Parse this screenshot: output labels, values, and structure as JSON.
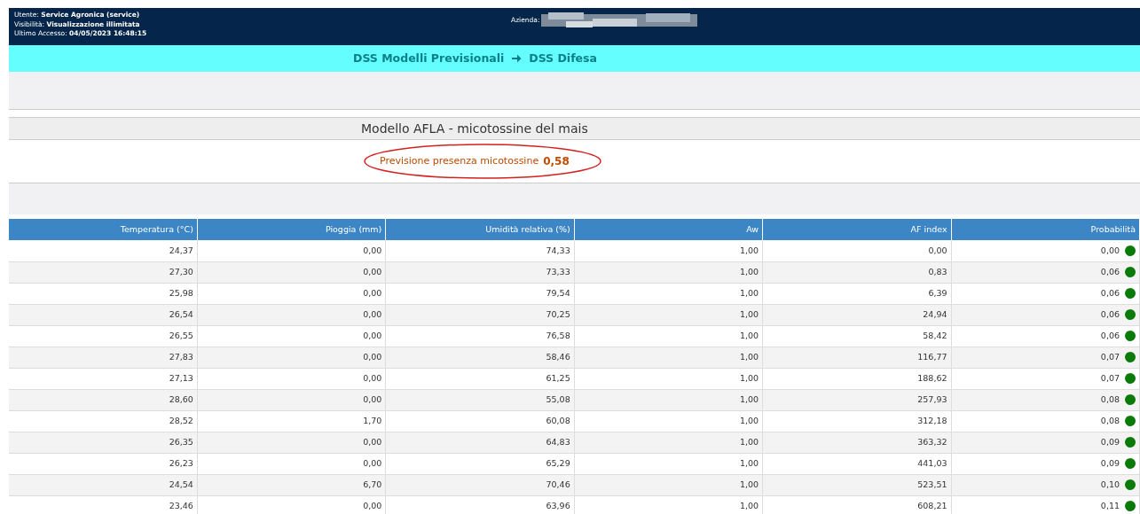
{
  "header": {
    "lines": [
      "Utente: **Service Agronica (service)**",
      "Visibilità: **Visualizzazione illimitata**",
      "Ultimo Accesso: **04/05/2023 16:48:15**"
    ],
    "company_label": "Azienda:"
  },
  "breadcrumb": [
    "DSS Modelli Previsionali",
    "DSS Difesa"
  ],
  "model_title": "Modello AFLA - micotossine del mais",
  "forecast": {
    "label": "Previsione presenza micotossine",
    "value": "0,58"
  },
  "table": {
    "columns": [
      "Temperatura (°C)",
      "Pioggia (mm)",
      "Umidità relativa (%)",
      "Aw",
      "AF index",
      "Probabilità"
    ],
    "rows": [
      {
        "cells": [
          "24,37",
          "0,00",
          "74,33",
          "1,00",
          "0,00",
          "0,00"
        ],
        "color": "#0b7a0b"
      },
      {
        "cells": [
          "27,30",
          "0,00",
          "73,33",
          "1,00",
          "0,83",
          "0,06"
        ],
        "color": "#0b7a0b"
      },
      {
        "cells": [
          "25,98",
          "0,00",
          "79,54",
          "1,00",
          "6,39",
          "0,06"
        ],
        "color": "#0b7a0b"
      },
      {
        "cells": [
          "26,54",
          "0,00",
          "70,25",
          "1,00",
          "24,94",
          "0,06"
        ],
        "color": "#0b7a0b"
      },
      {
        "cells": [
          "26,55",
          "0,00",
          "76,58",
          "1,00",
          "58,42",
          "0,06"
        ],
        "color": "#0b7a0b"
      },
      {
        "cells": [
          "27,83",
          "0,00",
          "58,46",
          "1,00",
          "116,77",
          "0,07"
        ],
        "color": "#0b7a0b"
      },
      {
        "cells": [
          "27,13",
          "0,00",
          "61,25",
          "1,00",
          "188,62",
          "0,07"
        ],
        "color": "#0b7a0b"
      },
      {
        "cells": [
          "28,60",
          "0,00",
          "55,08",
          "1,00",
          "257,93",
          "0,08"
        ],
        "color": "#0b7a0b"
      },
      {
        "cells": [
          "28,52",
          "1,70",
          "60,08",
          "1,00",
          "312,18",
          "0,08"
        ],
        "color": "#0b7a0b"
      },
      {
        "cells": [
          "26,35",
          "0,00",
          "64,83",
          "1,00",
          "363,32",
          "0,09"
        ],
        "color": "#0b7a0b"
      },
      {
        "cells": [
          "26,23",
          "0,00",
          "65,29",
          "1,00",
          "441,03",
          "0,09"
        ],
        "color": "#0b7a0b"
      },
      {
        "cells": [
          "24,54",
          "6,70",
          "70,46",
          "1,00",
          "523,51",
          "0,10"
        ],
        "color": "#0b7a0b"
      },
      {
        "cells": [
          "23,46",
          "0,00",
          "63,96",
          "1,00",
          "608,21",
          "0,11"
        ],
        "color": "#0b7a0b"
      }
    ]
  }
}
